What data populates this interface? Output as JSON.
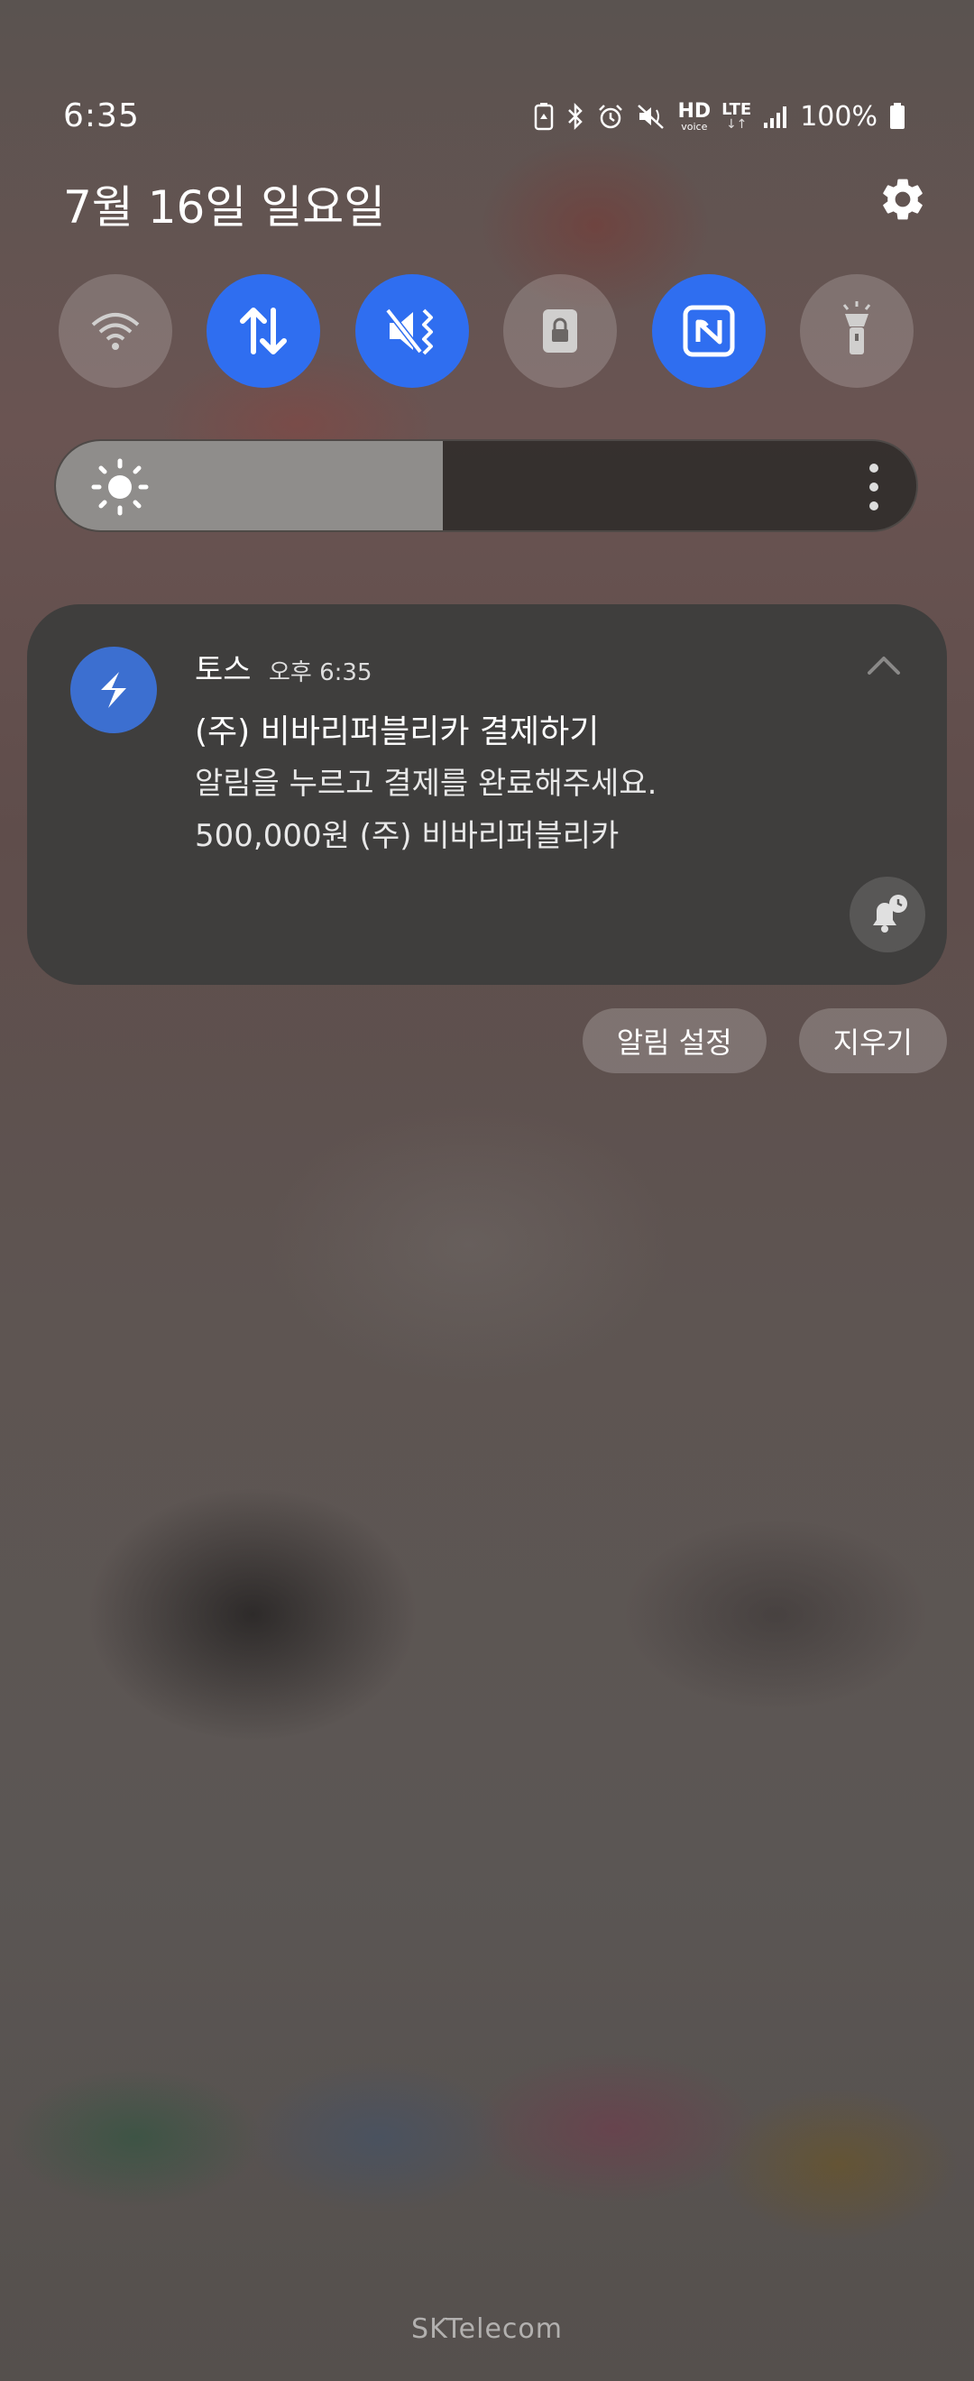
{
  "status_bar": {
    "time": "6:35",
    "hd_label": "HD",
    "voice_label": "voice",
    "lte_label": "LTE",
    "lte_arrows": "↓↑",
    "battery_pct": "100%",
    "icons": [
      "battery-saver-icon",
      "bluetooth-icon",
      "alarm-icon",
      "mute-icon",
      "hd-voice-icon",
      "lte-icon",
      "signal-icon",
      "battery-icon"
    ]
  },
  "header": {
    "date": "7월 16일 일요일",
    "settings_icon": "gear-icon"
  },
  "quick_toggles": [
    {
      "name": "wifi",
      "icon": "wifi-icon",
      "active": false
    },
    {
      "name": "mobile-data",
      "icon": "data-transfer-icon",
      "active": true
    },
    {
      "name": "sound-mode",
      "icon": "mute-vibrate-icon",
      "active": true
    },
    {
      "name": "rotation-lock",
      "icon": "lock-icon",
      "active": false
    },
    {
      "name": "nfc",
      "icon": "nfc-icon",
      "active": true
    },
    {
      "name": "flashlight",
      "icon": "flashlight-icon",
      "active": false
    }
  ],
  "brightness": {
    "level": 0.45,
    "icon": "sun-icon",
    "more_icon": "more-vertical-icon"
  },
  "colors": {
    "accent": "#2f6ef0",
    "card_bg": "#3f3e3d",
    "app_icon_bg": "#3c6fd0"
  },
  "notification": {
    "app_name": "토스",
    "time": "오후 6:35",
    "title": "(주) 비바리퍼블리카 결제하기",
    "body": "알림을 누르고 결제를 완료해주세요.\n500,000원 (주) 비바리퍼블리카",
    "app_icon": "toss-icon",
    "collapse_icon": "chevron-up-icon",
    "snooze_icon": "bell-snooze-icon"
  },
  "actions": {
    "settings_label": "알림 설정",
    "clear_label": "지우기"
  },
  "carrier": "SKTelecom"
}
